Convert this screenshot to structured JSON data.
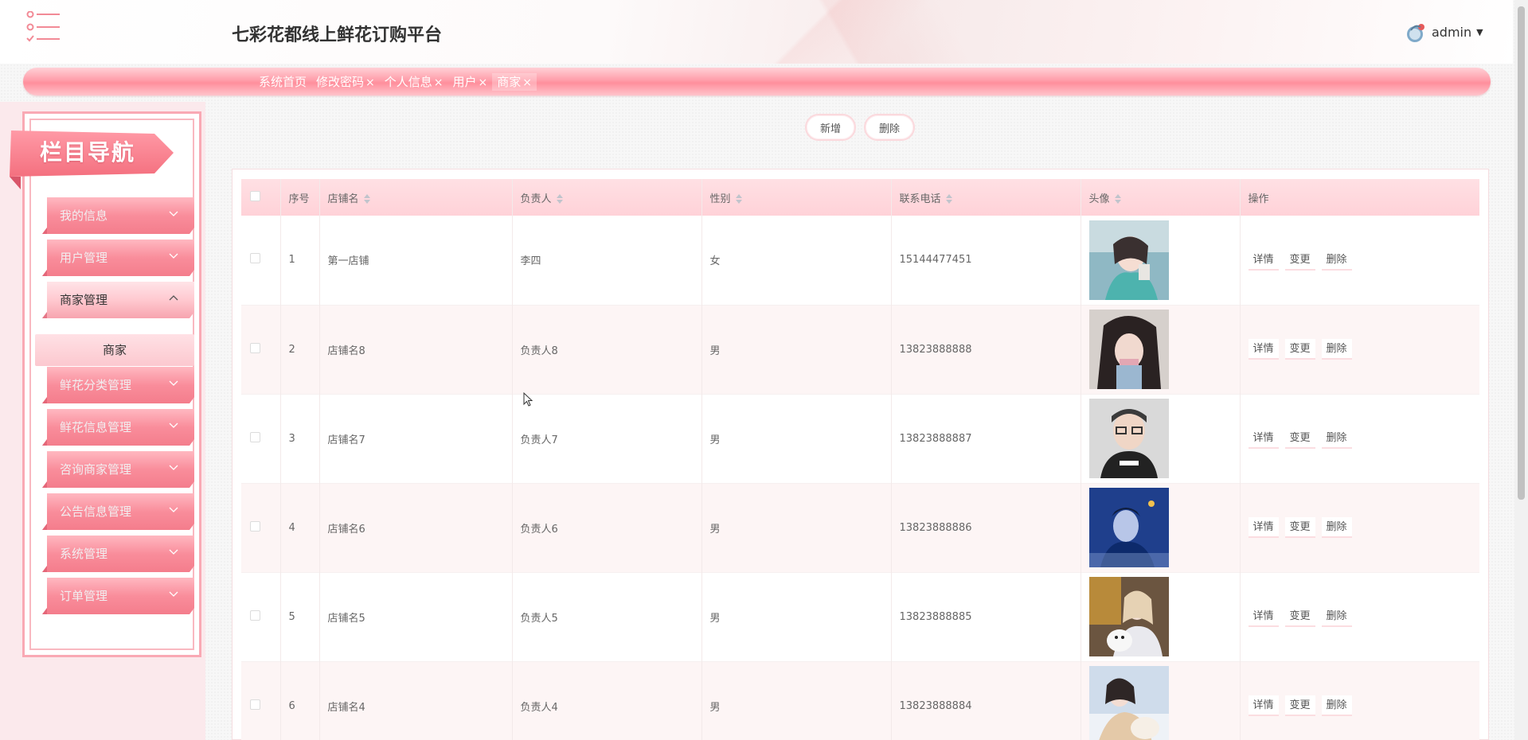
{
  "header": {
    "title": "七彩花都线上鲜花订购平台",
    "user": "admin"
  },
  "tabs": [
    {
      "label": "系统首页",
      "closable": false,
      "active": false
    },
    {
      "label": "修改密码",
      "closable": true,
      "active": false
    },
    {
      "label": "个人信息",
      "closable": true,
      "active": false
    },
    {
      "label": "用户",
      "closable": true,
      "active": false
    },
    {
      "label": "商家",
      "closable": true,
      "active": true
    }
  ],
  "tab_close_glyph": "×",
  "sidebar": {
    "banner": "栏目导航",
    "items": [
      {
        "label": "我的信息",
        "open": false
      },
      {
        "label": "用户管理",
        "open": false
      },
      {
        "label": "商家管理",
        "open": true
      },
      {
        "label": "鲜花分类管理",
        "open": false
      },
      {
        "label": "鲜花信息管理",
        "open": false
      },
      {
        "label": "咨询商家管理",
        "open": false
      },
      {
        "label": "公告信息管理",
        "open": false
      },
      {
        "label": "系统管理",
        "open": false
      },
      {
        "label": "订单管理",
        "open": false
      }
    ],
    "sub_item": "商家"
  },
  "actions": {
    "add": "新增",
    "delete": "删除"
  },
  "table": {
    "columns": {
      "index": "序号",
      "shop_name": "店铺名",
      "owner": "负责人",
      "gender": "性别",
      "phone": "联系电话",
      "avatar": "头像",
      "ops": "操作"
    },
    "row_actions": {
      "detail": "详情",
      "edit": "变更",
      "delete": "删除"
    },
    "rows": [
      {
        "index": "1",
        "shop_name": "第一店铺",
        "owner": "李四",
        "gender": "女",
        "phone": "15144477451",
        "avatar": "avatar-woman-teal-scarf"
      },
      {
        "index": "2",
        "shop_name": "店铺名8",
        "owner": "负责人8",
        "gender": "男",
        "phone": "13823888888",
        "avatar": "avatar-woman-dark-hair"
      },
      {
        "index": "3",
        "shop_name": "店铺名7",
        "owner": "负责人7",
        "gender": "男",
        "phone": "13823888887",
        "avatar": "avatar-man-glasses"
      },
      {
        "index": "4",
        "shop_name": "店铺名6",
        "owner": "负责人6",
        "gender": "男",
        "phone": "13823888886",
        "avatar": "avatar-man-blue-night"
      },
      {
        "index": "5",
        "shop_name": "店铺名5",
        "owner": "负责人5",
        "gender": "男",
        "phone": "13823888885",
        "avatar": "avatar-woman-with-dog"
      },
      {
        "index": "6",
        "shop_name": "店铺名4",
        "owner": "负责人4",
        "gender": "男",
        "phone": "13823888884",
        "avatar": "avatar-woman-snow"
      }
    ]
  },
  "colors": {
    "accent": "#ff8f9c",
    "accent_light": "#ffd2d8",
    "sidebar_bg": "#fbe9ec"
  }
}
